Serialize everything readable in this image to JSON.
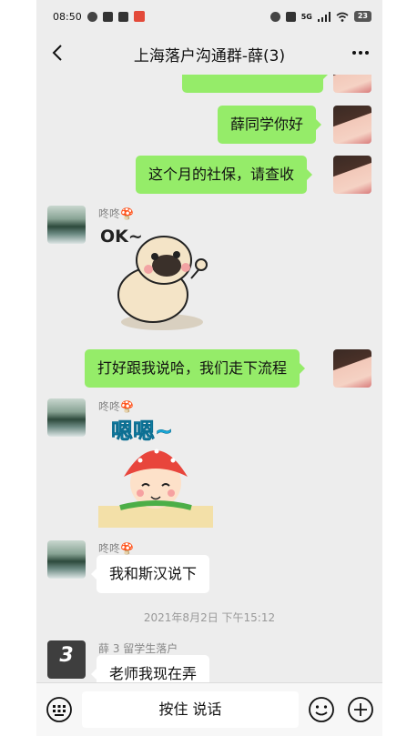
{
  "status": {
    "time": "08:50",
    "net": "5G",
    "battery": "23"
  },
  "header": {
    "title": "上海落户沟通群-薛(3)"
  },
  "messages": {
    "m1": "薛同学你好",
    "m2": "这个月的社保，请查收",
    "m3_sender": "咚咚🍄",
    "m3_sticker": "OK~",
    "m4": "打好跟我说哈，我们走下流程",
    "m5_sender": "咚咚🍄",
    "m5_sticker": "嗯嗯~",
    "m6_sender": "咚咚🍄",
    "m6": "我和斯汉说下",
    "timestamp": "2021年8月2日 下午15:12",
    "m7_sender": "薛 3 留学生落户",
    "m7": "老师我现在弄",
    "avatar_badge": "3"
  },
  "input": {
    "hold_label": "按住 说话"
  },
  "colors": {
    "bubble_green": "#95ec69",
    "background": "#ededed"
  }
}
